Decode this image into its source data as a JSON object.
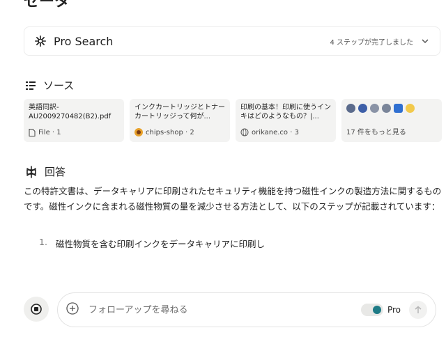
{
  "top_clip": "ゼータ",
  "pro_search": {
    "title": "Pro Search",
    "steps_status": "4 ステップが完了しました"
  },
  "sources": {
    "heading": "ソース",
    "cards": [
      {
        "title": "英語同訳-AU2009270482(B2).pdf",
        "meta": "File · 1",
        "icon": "file-icon"
      },
      {
        "title": "インクカートリッジとトナーカートリッジって何が...",
        "meta": "chips-shop · 2",
        "icon": "chips-shop-favicon"
      },
      {
        "title": "印刷の基本！印刷に使うインキはどのようなもの？|...",
        "meta": "orikane.co · 3",
        "icon": "globe-icon"
      }
    ],
    "more_label": "17 件をもっと見る",
    "more_favicons": [
      "#5b6b8c",
      "#3d5fa8",
      "#8a93a6",
      "#7a8599",
      "#2f6fd1",
      "#f2c94c"
    ]
  },
  "answer": {
    "heading": "回答",
    "body": "この特許文書は、データキャリアに印刷されたセキュリティ機能を持つ磁性インクの製造方法に関するものです。磁性インクに含まれる磁性物質の量を減少させる方法として、以下のステップが記載されています：",
    "list": [
      {
        "num": "1.",
        "text": "磁性物質を含む印刷インクをデータキャリアに印刷し"
      }
    ]
  },
  "followup": {
    "placeholder": "フォローアップを尋ねる",
    "pro_label": "Pro"
  },
  "colors": {
    "accent": "#1e7b86",
    "card_bg": "#f3f3f2"
  }
}
